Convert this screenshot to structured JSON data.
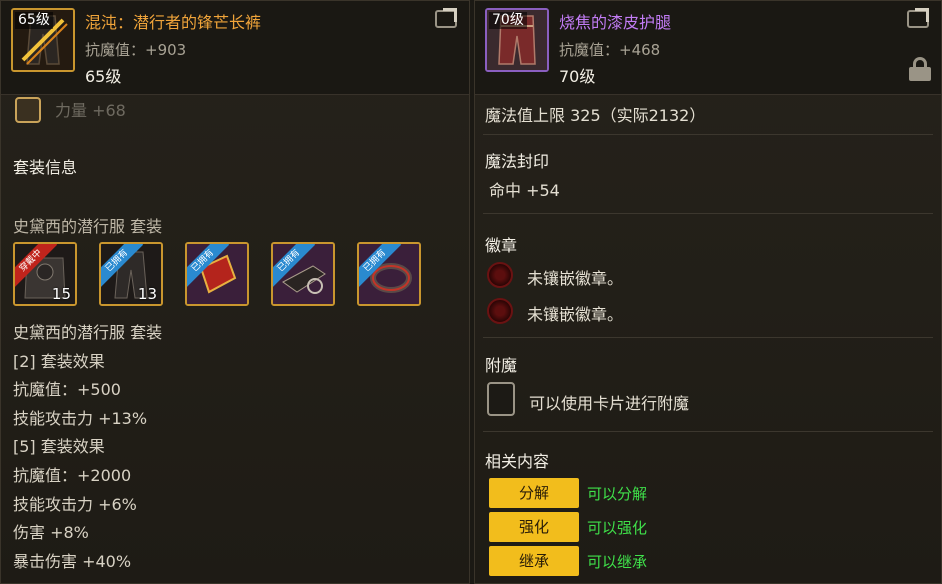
{
  "left": {
    "item_level_badge": "65级",
    "item_name": "混沌：潜行者的锋芒长裤",
    "stat": "抗魔值：+903",
    "level_text": "65级",
    "partial_stat": "力量 +68",
    "set_info_heading": "套装信息",
    "set_title_top": "史黛西的潜行服 套装",
    "set_pieces": [
      {
        "ribbon": "穿戴中",
        "count": "15"
      },
      {
        "ribbon": "已拥有",
        "count": "13"
      },
      {
        "ribbon": "已拥有",
        "count": ""
      },
      {
        "ribbon": "已拥有",
        "count": ""
      },
      {
        "ribbon": "已拥有",
        "count": ""
      }
    ],
    "set_lines": [
      "史黛西的潜行服 套装",
      "[2] 套装效果",
      "抗魔值：+500",
      "技能攻击力 +13%",
      "[5] 套装效果",
      "抗魔值：+2000",
      "技能攻击力 +6%",
      "伤害 +8%",
      "暴击伤害 +40%"
    ]
  },
  "right": {
    "item_level_badge": "70级",
    "item_name": "烧焦的漆皮护腿",
    "stat": "抗魔值：+468",
    "level_text": "70级",
    "mp_line": "魔法值上限 325（实际2132）",
    "magic_seal_heading": "魔法封印",
    "magic_seal_value": "命中 +54",
    "emblem_heading": "徽章",
    "emblem_slots": [
      "未镶嵌徽章。",
      "未镶嵌徽章。"
    ],
    "enchant_heading": "附魔",
    "enchant_text": "可以使用卡片进行附魔",
    "related_heading": "相关内容",
    "actions": [
      {
        "button": "分解",
        "note": "可以分解"
      },
      {
        "button": "强化",
        "note": "可以强化"
      },
      {
        "button": "继承",
        "note": "可以继承"
      }
    ]
  },
  "colors": {
    "legendary_name": "#f0a43a",
    "epic_name": "#c27cf5",
    "green_note": "#3fe04a",
    "button_yellow": "#f2bd1c"
  }
}
